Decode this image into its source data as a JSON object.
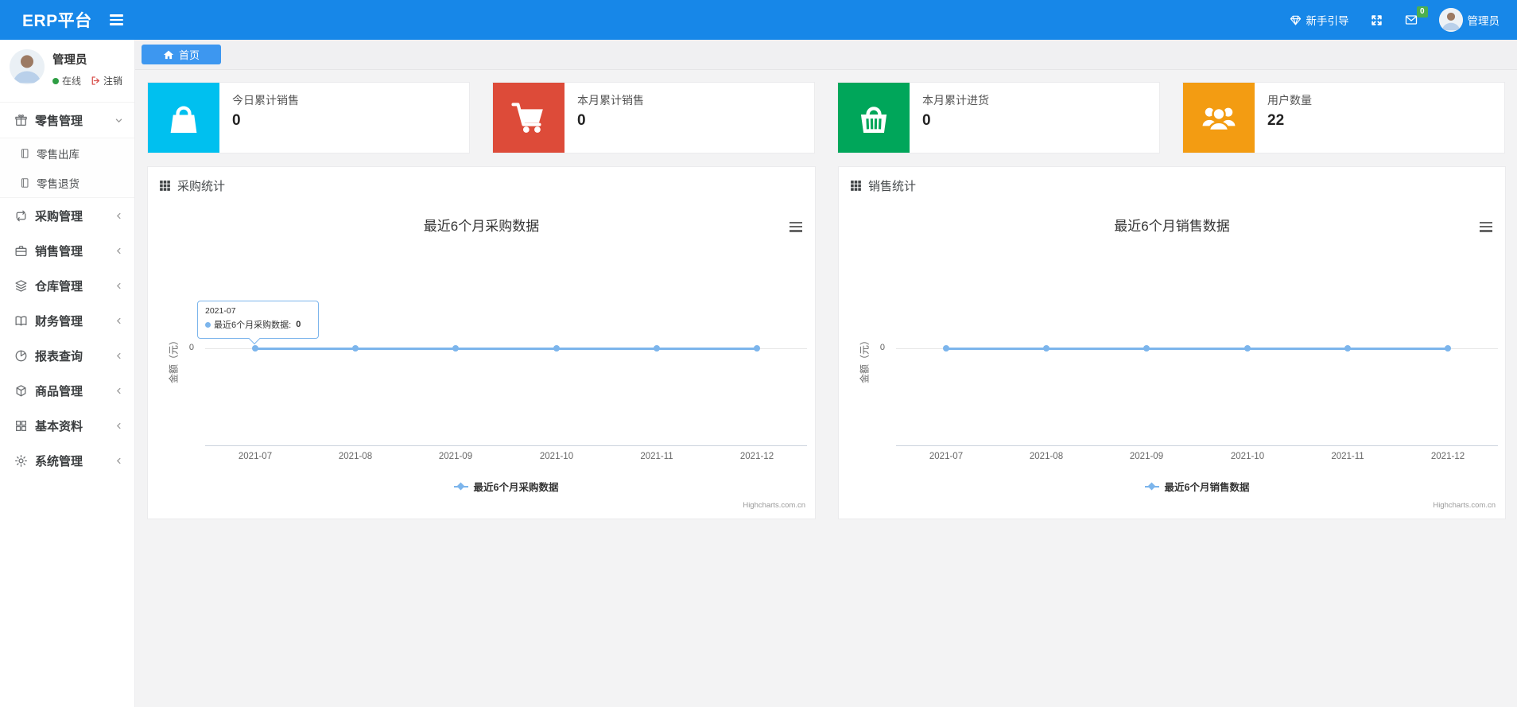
{
  "navbar": {
    "brand": "ERP平台",
    "guide_label": "新手引导",
    "mail_badge": "0",
    "username": "管理员"
  },
  "breadcrumb": {
    "home_label": "首页"
  },
  "sidebar": {
    "user": {
      "name": "管理员",
      "status_online": "在线",
      "logout_label": "注销"
    },
    "menu": [
      {
        "label": "零售管理",
        "icon": "gift-icon",
        "state": "expanded",
        "children": [
          {
            "label": "零售出库",
            "icon": "journal-icon"
          },
          {
            "label": "零售退货",
            "icon": "journal-icon"
          }
        ]
      },
      {
        "label": "采购管理",
        "icon": "repeat-icon"
      },
      {
        "label": "销售管理",
        "icon": "briefcase-icon"
      },
      {
        "label": "仓库管理",
        "icon": "layers-icon"
      },
      {
        "label": "财务管理",
        "icon": "book-open-icon"
      },
      {
        "label": "报表查询",
        "icon": "pie-chart-icon"
      },
      {
        "label": "商品管理",
        "icon": "box-icon"
      },
      {
        "label": "基本资料",
        "icon": "grid-icon"
      },
      {
        "label": "系统管理",
        "icon": "gear-icon"
      }
    ]
  },
  "cards": [
    {
      "title": "今日累计销售",
      "value": "0",
      "color": "#00c0ef",
      "icon": "shopping-bag-icon"
    },
    {
      "title": "本月累计销售",
      "value": "0",
      "color": "#dd4b39",
      "icon": "shopping-cart-icon"
    },
    {
      "title": "本月累计进货",
      "value": "0",
      "color": "#00a65a",
      "icon": "shopping-basket-icon"
    },
    {
      "title": "用户数量",
      "value": "22",
      "color": "#f39c12",
      "icon": "users-icon"
    }
  ],
  "panels": [
    {
      "header": "采购统计",
      "credit": "Highcharts.com.cn"
    },
    {
      "header": "销售统计",
      "credit": "Highcharts.com.cn"
    }
  ],
  "tooltip": {
    "header": "2021-07",
    "series_label": "最近6个月采购数据:",
    "value": "0"
  },
  "chart_data": [
    {
      "type": "line",
      "title": "最近6个月采购数据",
      "categories": [
        "2021-07",
        "2021-08",
        "2021-09",
        "2021-10",
        "2021-11",
        "2021-12"
      ],
      "series": [
        {
          "name": "最近6个月采购数据",
          "values": [
            0,
            0,
            0,
            0,
            0,
            0
          ]
        }
      ],
      "ylabel": "金额（元）",
      "ytick_labels": [
        "0"
      ],
      "line_color": "#7cb5ec",
      "legend_position": "bottom",
      "grid": true
    },
    {
      "type": "line",
      "title": "最近6个月销售数据",
      "categories": [
        "2021-07",
        "2021-08",
        "2021-09",
        "2021-10",
        "2021-11",
        "2021-12"
      ],
      "series": [
        {
          "name": "最近6个月销售数据",
          "values": [
            0,
            0,
            0,
            0,
            0,
            0
          ]
        }
      ],
      "ylabel": "金额（元）",
      "ytick_labels": [
        "0"
      ],
      "line_color": "#7cb5ec",
      "legend_position": "bottom",
      "grid": true
    }
  ]
}
